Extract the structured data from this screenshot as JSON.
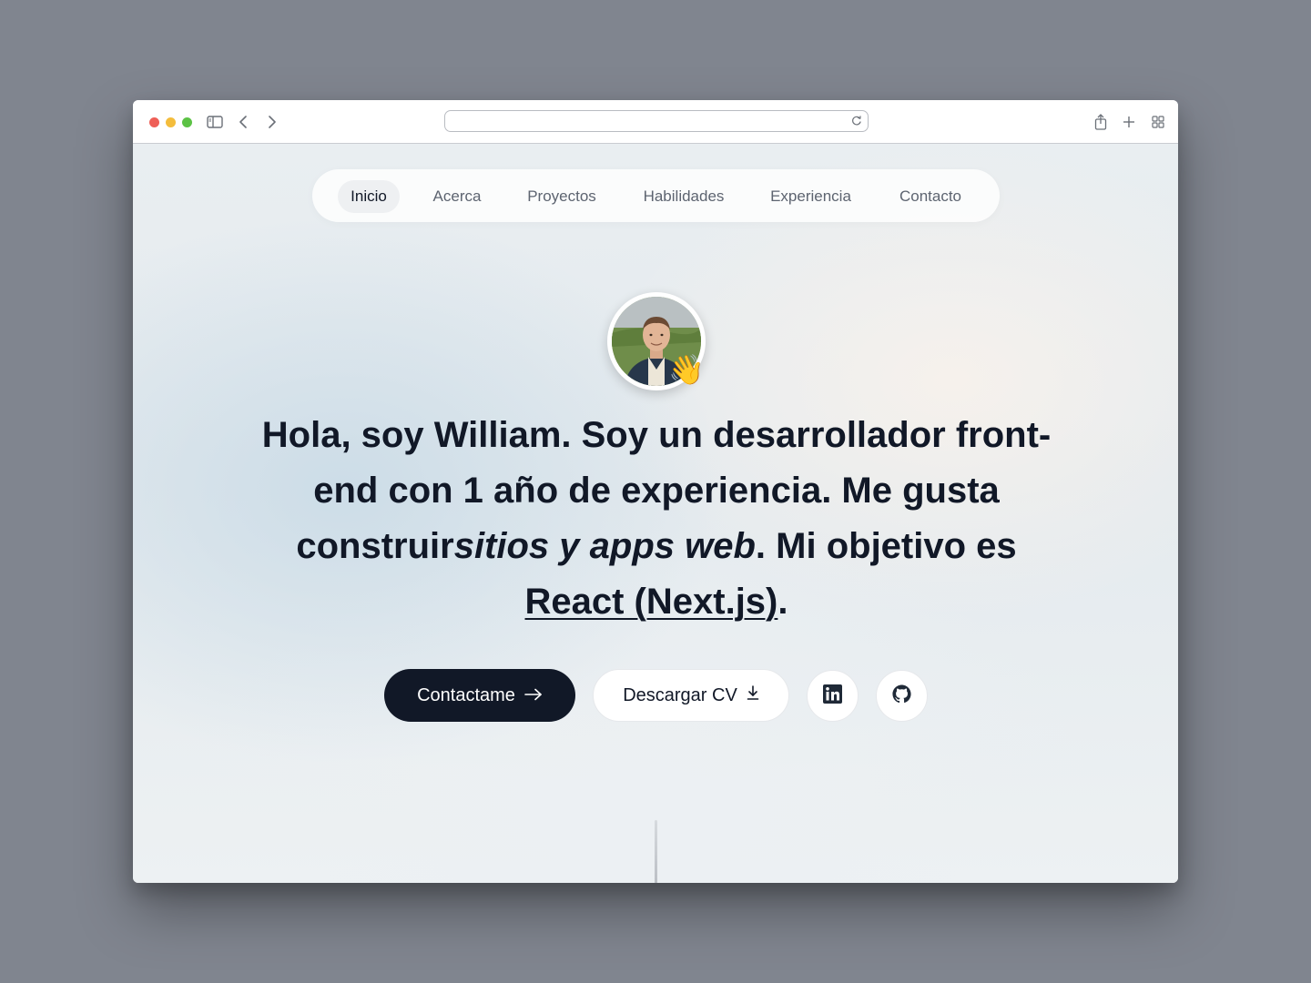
{
  "browser": {
    "url": "",
    "icons": [
      "sidebar-icon",
      "back-icon",
      "forward-icon",
      "reload-icon",
      "share-icon",
      "new-tab-icon",
      "tab-overview-icon"
    ]
  },
  "nav": {
    "items": [
      {
        "label": "Inicio",
        "active": true
      },
      {
        "label": "Acerca",
        "active": false
      },
      {
        "label": "Proyectos",
        "active": false
      },
      {
        "label": "Habilidades",
        "active": false
      },
      {
        "label": "Experiencia",
        "active": false
      },
      {
        "label": "Contacto",
        "active": false
      }
    ]
  },
  "hero": {
    "wave_emoji": "👋",
    "line1_bold": "Hola, soy William.",
    "line1_regular": " Soy un ",
    "line1_bold2": "desarrollador front-end",
    "line2_regular": " con ",
    "line2_bold": "1 año",
    "line2_regular2": " de experiencia. Me gusta construir",
    "italic": "sitios y apps web",
    "line3_regular": ". Mi objetivo es ",
    "link": "React (Next.js)",
    "end": "."
  },
  "actions": {
    "contact_label": "Contactame",
    "cv_label": "Descargar CV",
    "linkedin_icon": "linkedin-icon",
    "github_icon": "github-icon"
  },
  "colors": {
    "primary": "#111827",
    "nav_text": "#5d6470",
    "traffic_red": "#ee5f57",
    "traffic_yellow": "#f4bd3c",
    "traffic_green": "#5cc245"
  }
}
